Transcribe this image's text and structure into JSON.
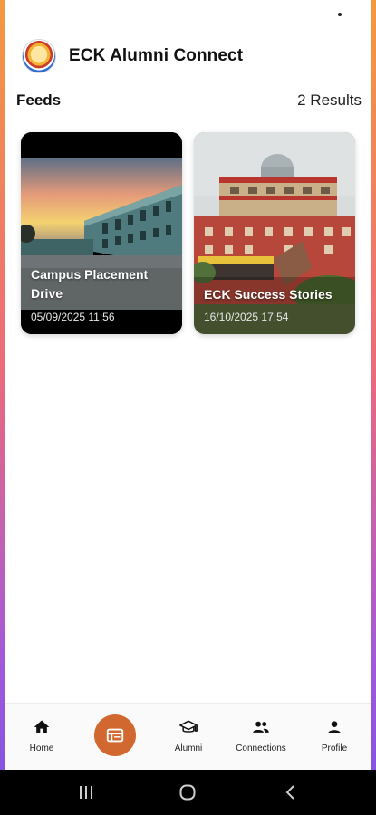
{
  "header": {
    "title": "ECK Alumni Connect"
  },
  "feeds": {
    "title": "Feeds",
    "results": "2 Results"
  },
  "cards": [
    {
      "title": "Campus Placement Drive",
      "date": "05/09/2025 11:56"
    },
    {
      "title": "ECK Success Stories",
      "date": "16/10/2025 17:54"
    }
  ],
  "nav": {
    "home": "Home",
    "center": "feeds-icon",
    "alumni": "Alumni",
    "connections": "Connections",
    "profile": "Profile"
  },
  "colors": {
    "accent": "#d0682f",
    "gradient_top": "#f39a3e",
    "gradient_bottom": "#7b52e6"
  }
}
